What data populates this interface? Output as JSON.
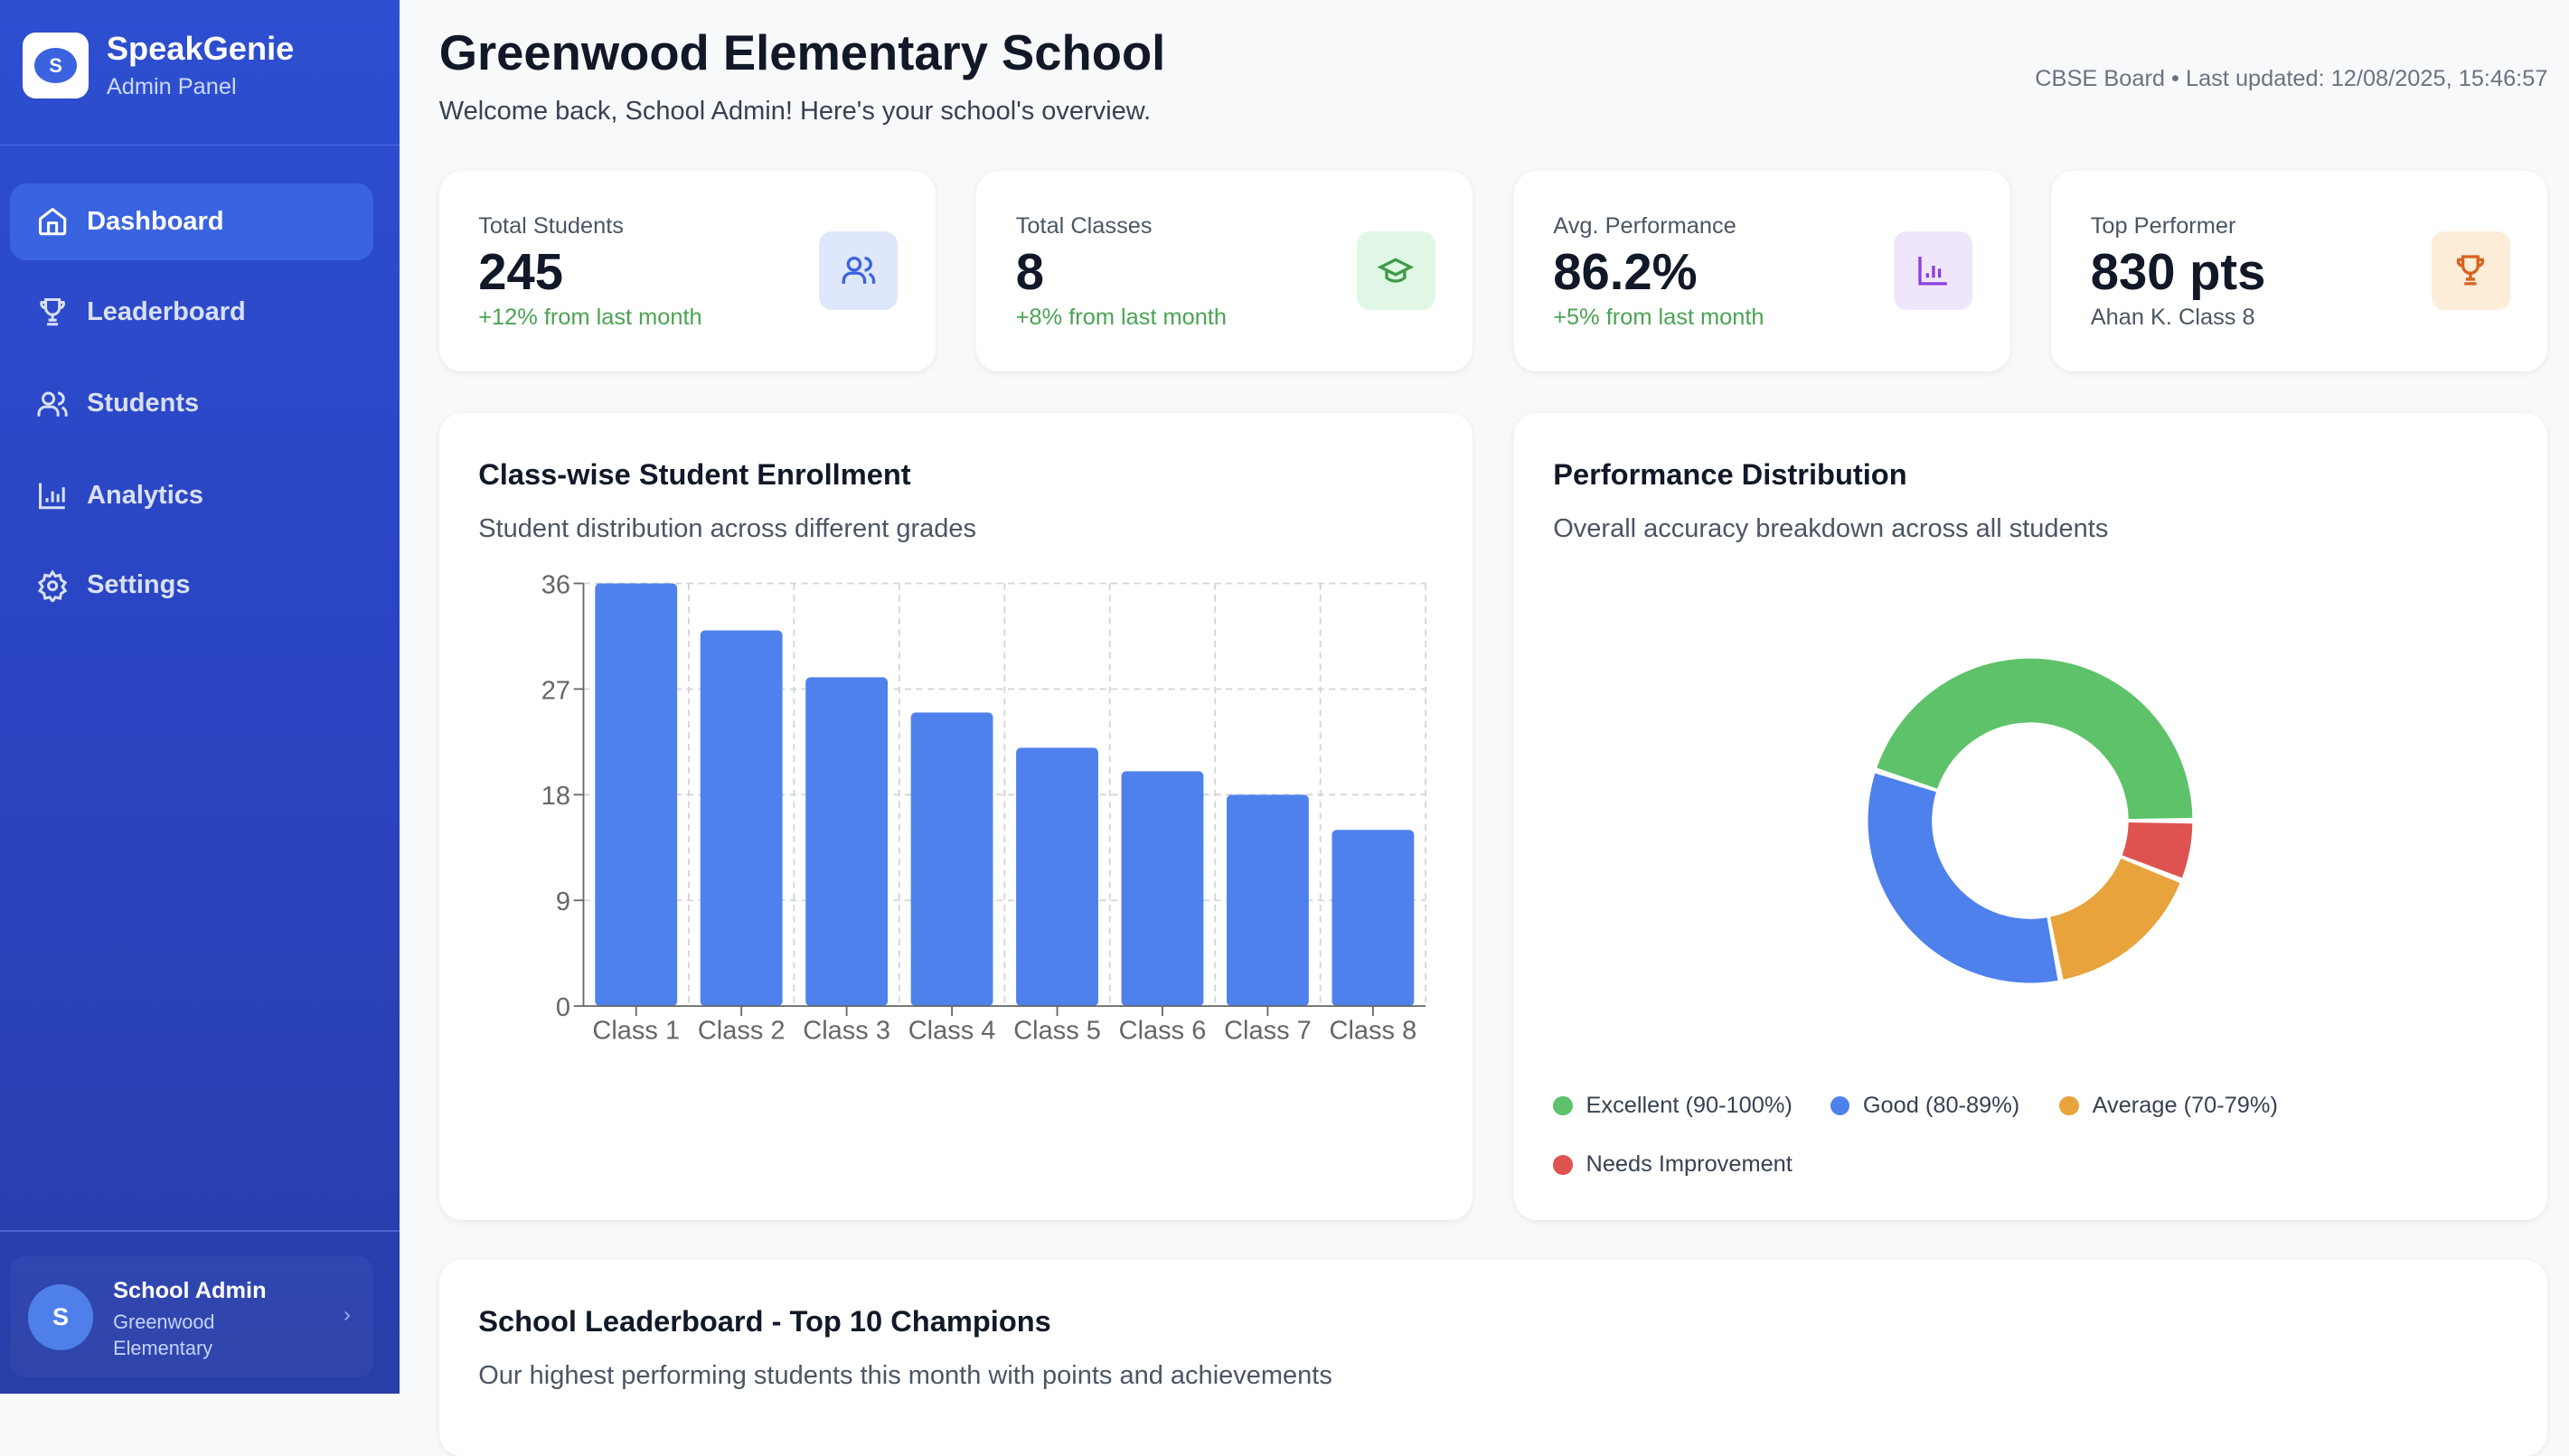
{
  "sidebar": {
    "brand": "SpeakGenie",
    "brand_sub": "Admin Panel",
    "logo_letter": "S",
    "items": [
      {
        "label": "Dashboard",
        "icon": "home-icon",
        "active": true
      },
      {
        "label": "Leaderboard",
        "icon": "trophy-icon"
      },
      {
        "label": "Students",
        "icon": "users-icon"
      },
      {
        "label": "Analytics",
        "icon": "bar-chart-icon"
      },
      {
        "label": "Settings",
        "icon": "gear-icon"
      }
    ],
    "user": {
      "initial": "S",
      "name": "School Admin",
      "school": "Greenwood Elementary"
    }
  },
  "header": {
    "title": "Greenwood Elementary School",
    "subtitle": "Welcome back, School Admin! Here's your school's overview.",
    "meta": "CBSE Board • Last updated: 12/08/2025, 15:46:57"
  },
  "stats": [
    {
      "label": "Total Students",
      "value": "245",
      "delta": "+12% from last month",
      "icon": "users-icon",
      "color": "#3b63e0",
      "bg": "#dfe8fb"
    },
    {
      "label": "Total Classes",
      "value": "8",
      "delta": "+8% from last month",
      "icon": "graduation-cap-icon",
      "color": "#3f9a4a",
      "bg": "#e1f7e5"
    },
    {
      "label": "Avg. Performance",
      "value": "86.2%",
      "delta": "+5% from last month",
      "icon": "bar-chart-icon",
      "color": "#8a3fe0",
      "bg": "#f0e6fb"
    },
    {
      "label": "Top Performer",
      "value": "830 pts",
      "delta": "Ahan K. Class 8",
      "icon": "trophy-icon",
      "color": "#d9621f",
      "bg": "#fdecd8"
    }
  ],
  "enrollment": {
    "title": "Class-wise Student Enrollment",
    "subtitle": "Student distribution across different grades"
  },
  "performance": {
    "title": "Performance Distribution",
    "subtitle": "Overall accuracy breakdown across all students"
  },
  "leaderboard": {
    "title": "School Leaderboard - Top 10 Champions",
    "subtitle": "Our highest performing students this month with points and achievements"
  },
  "chart_data": [
    {
      "type": "bar",
      "categories": [
        "Class 1",
        "Class 2",
        "Class 3",
        "Class 4",
        "Class 5",
        "Class 6",
        "Class 7",
        "Class 8"
      ],
      "values": [
        36,
        32,
        28,
        25,
        22,
        20,
        18,
        15
      ],
      "yticks": [
        "0",
        "9",
        "18",
        "27",
        "36"
      ],
      "ylim": [
        0,
        36
      ],
      "grid": true,
      "color": "#4f81ec"
    },
    {
      "type": "pie",
      "donut": true,
      "labels": [
        "Excellent (90-100%)",
        "Good (80-89%)",
        "Average (70-79%)",
        "Needs Improvement"
      ],
      "values": [
        45,
        33,
        16,
        6
      ],
      "colors": [
        "#5ec26a",
        "#4f81ec",
        "#e8a33c",
        "#de5350"
      ],
      "legend": "bottom"
    }
  ]
}
